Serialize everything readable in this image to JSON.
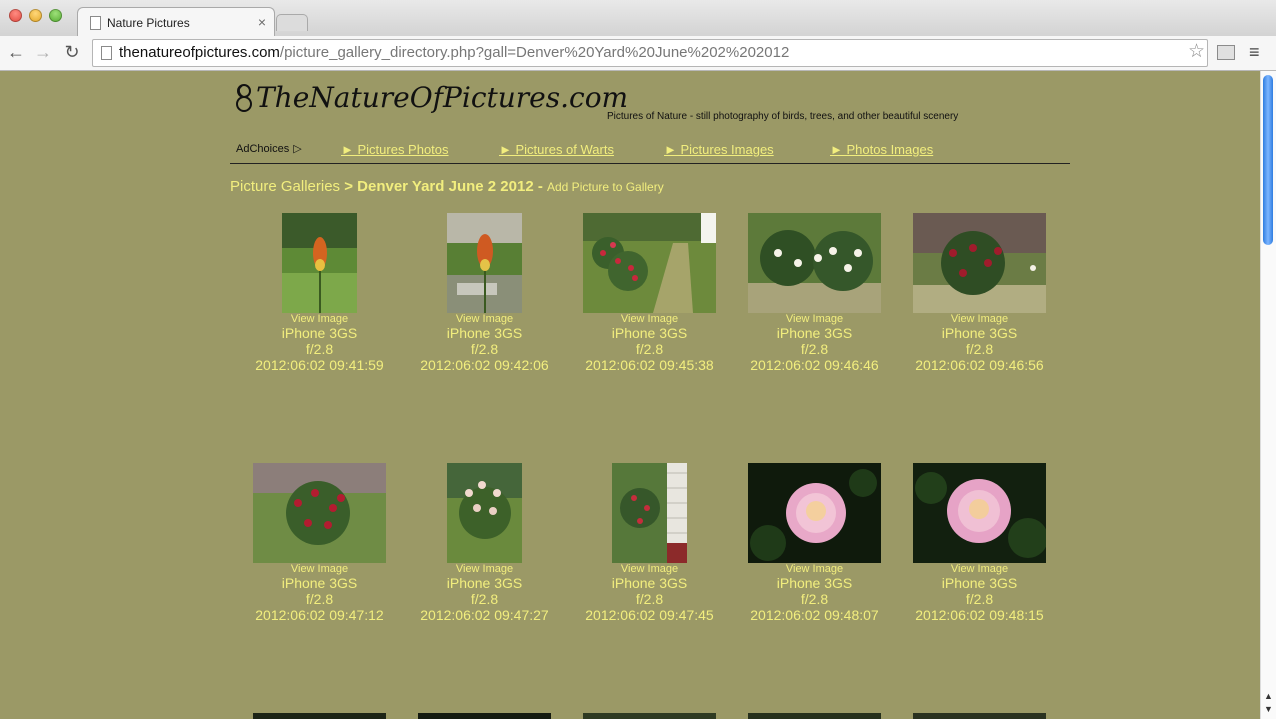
{
  "browser": {
    "tab_title": "Nature Pictures",
    "tab_close": "×",
    "url_host": "thenatureofpictures.com",
    "url_path": "/picture_gallery_directory.php?gall=Denver%20Yard%20June%202%202012",
    "back": "←",
    "forward": "→",
    "reload": "↻",
    "star": "☆",
    "menu": "≡"
  },
  "site": {
    "logo_text": "TheNatureOfPictures.com",
    "tagline": "Pictures of Nature - still photography of birds, trees, and other beautiful scenery"
  },
  "nav": {
    "adchoices": "AdChoices",
    "adchoices_icon": "▷",
    "links": [
      "► Pictures Photos",
      "► Pictures of Warts",
      "► Pictures Images",
      "► Photos Images"
    ]
  },
  "breadcrumb": {
    "home": "Picture Galleries",
    "separator": " > ",
    "current": "Denver Yard June 2 2012",
    "dash": " - ",
    "add": "Add Picture to Gallery"
  },
  "gallery": {
    "view_label": "View Image",
    "items": [
      {
        "camera": "iPhone 3GS",
        "aperture": "f/2.8",
        "timestamp": "2012:06:02 09:41:59",
        "orientation": "portrait",
        "scene": "red hot poker flower"
      },
      {
        "camera": "iPhone 3GS",
        "aperture": "f/2.8",
        "timestamp": "2012:06:02 09:42:06",
        "orientation": "portrait",
        "scene": "red hot poker flower"
      },
      {
        "camera": "iPhone 3GS",
        "aperture": "f/2.8",
        "timestamp": "2012:06:02 09:45:38",
        "orientation": "landscape",
        "scene": "rose bushes and grass path"
      },
      {
        "camera": "iPhone 3GS",
        "aperture": "f/2.8",
        "timestamp": "2012:06:02 09:46:46",
        "orientation": "landscape",
        "scene": "white roses"
      },
      {
        "camera": "iPhone 3GS",
        "aperture": "f/2.8",
        "timestamp": "2012:06:02 09:46:56",
        "orientation": "landscape",
        "scene": "red rose bush by fence"
      },
      {
        "camera": "iPhone 3GS",
        "aperture": "f/2.8",
        "timestamp": "2012:06:02 09:47:12",
        "orientation": "landscape",
        "scene": "red rose bush"
      },
      {
        "camera": "iPhone 3GS",
        "aperture": "f/2.8",
        "timestamp": "2012:06:02 09:47:27",
        "orientation": "portrait",
        "scene": "pale rose bush"
      },
      {
        "camera": "iPhone 3GS",
        "aperture": "f/2.8",
        "timestamp": "2012:06:02 09:47:45",
        "orientation": "portrait",
        "scene": "rose bush by house siding"
      },
      {
        "camera": "iPhone 3GS",
        "aperture": "f/2.8",
        "timestamp": "2012:06:02 09:48:07",
        "orientation": "landscape",
        "scene": "pink rose close-up"
      },
      {
        "camera": "iPhone 3GS",
        "aperture": "f/2.8",
        "timestamp": "2012:06:02 09:48:15",
        "orientation": "landscape",
        "scene": "pink rose close-up"
      }
    ]
  }
}
